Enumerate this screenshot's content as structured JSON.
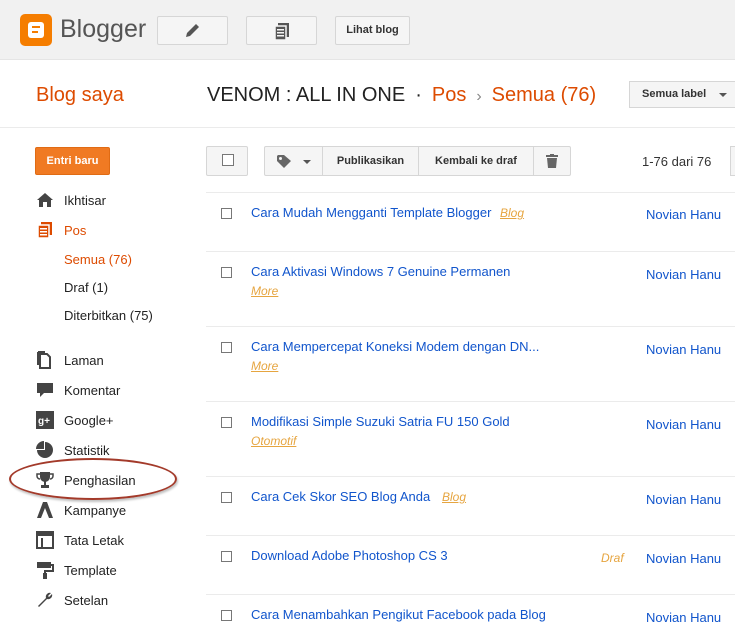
{
  "app": {
    "name": "Blogger",
    "view_blog_label": "Lihat blog"
  },
  "header": {
    "section_title": "Blog saya",
    "blog_name": "VENOM : ALL IN ONE",
    "separator": "·",
    "crumb_posts": "Pos",
    "crumb_arrow": "›",
    "crumb_all": "Semua (76)",
    "label_filter": "Semua label"
  },
  "sidebar": {
    "new_post": "Entri baru",
    "items": [
      {
        "label": "Ikhtisar",
        "icon": "home-icon"
      },
      {
        "label": "Pos",
        "icon": "posts-icon",
        "active": true
      },
      {
        "label": "Laman",
        "icon": "pages-icon"
      },
      {
        "label": "Komentar",
        "icon": "comment-icon"
      },
      {
        "label": "Google+",
        "icon": "google-plus-icon"
      },
      {
        "label": "Statistik",
        "icon": "stats-icon"
      },
      {
        "label": "Penghasilan",
        "icon": "earnings-icon"
      },
      {
        "label": "Kampanye",
        "icon": "campaign-icon"
      },
      {
        "label": "Tata Letak",
        "icon": "layout-icon"
      },
      {
        "label": "Template",
        "icon": "template-icon"
      },
      {
        "label": "Setelan",
        "icon": "settings-icon"
      }
    ],
    "sub_items": [
      {
        "label": "Semua (76)",
        "active": true
      },
      {
        "label": "Draf (1)"
      },
      {
        "label": "Diterbitkan (75)"
      }
    ]
  },
  "toolbar": {
    "publish": "Publikasikan",
    "revert_draft": "Kembali ke draf",
    "range": "1-76 dari 76"
  },
  "posts": [
    {
      "title": "Cara Mudah Mengganti Template Blogger",
      "label": "Blog",
      "status": "",
      "author": "Novian Hanu"
    },
    {
      "title": "Cara Aktivasi Windows 7 Genuine Permanen",
      "label": "More",
      "status": "",
      "author": "Novian Hanu"
    },
    {
      "title": "Cara Mempercepat Koneksi Modem dengan DN...",
      "label": "More",
      "status": "",
      "author": "Novian Hanu"
    },
    {
      "title": "Modifikasi Simple Suzuki Satria FU 150 Gold",
      "label": "Otomotif",
      "status": "",
      "author": "Novian Hanu"
    },
    {
      "title": "Cara Cek Skor SEO Blog Anda",
      "label": "Blog",
      "status": "",
      "author": "Novian Hanu"
    },
    {
      "title": "Download Adobe Photoshop CS 3",
      "label": "",
      "status": "Draf",
      "author": "Novian Hanu"
    },
    {
      "title": "Cara Menambahkan Pengikut Facebook pada Blog",
      "label": "",
      "status": "",
      "author": "Novian Hanu"
    }
  ],
  "colors": {
    "accent": "#dd4b00",
    "button": "#f07a23",
    "link": "#1155cc",
    "label": "#e6a540",
    "annotation": "#a33a2a"
  }
}
